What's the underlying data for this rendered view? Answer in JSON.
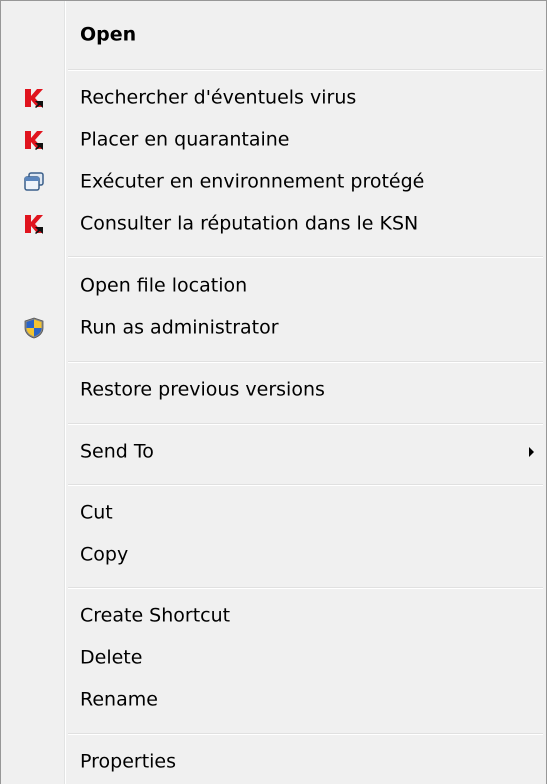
{
  "menu": {
    "open": "Open",
    "scan": "Rechercher d'éventuels virus",
    "quarantine": "Placer en quarantaine",
    "sandbox": "Exécuter en environnement protégé",
    "reputation": "Consulter la réputation dans le KSN",
    "open_location": "Open file location",
    "run_admin": "Run as administrator",
    "restore": "Restore previous versions",
    "send_to": "Send To",
    "cut": "Cut",
    "copy": "Copy",
    "create_shortcut": "Create Shortcut",
    "delete": "Delete",
    "rename": "Rename",
    "properties": "Properties"
  },
  "icons": {
    "kaspersky": "kaspersky-icon",
    "sandbox": "window-stack-icon",
    "uac": "uac-shield-icon",
    "submenu": "chevron-right-icon"
  },
  "colors": {
    "menu_bg": "#f0f0f0",
    "kaspersky_red": "#e0141e",
    "separator": "#e0e0e0"
  }
}
